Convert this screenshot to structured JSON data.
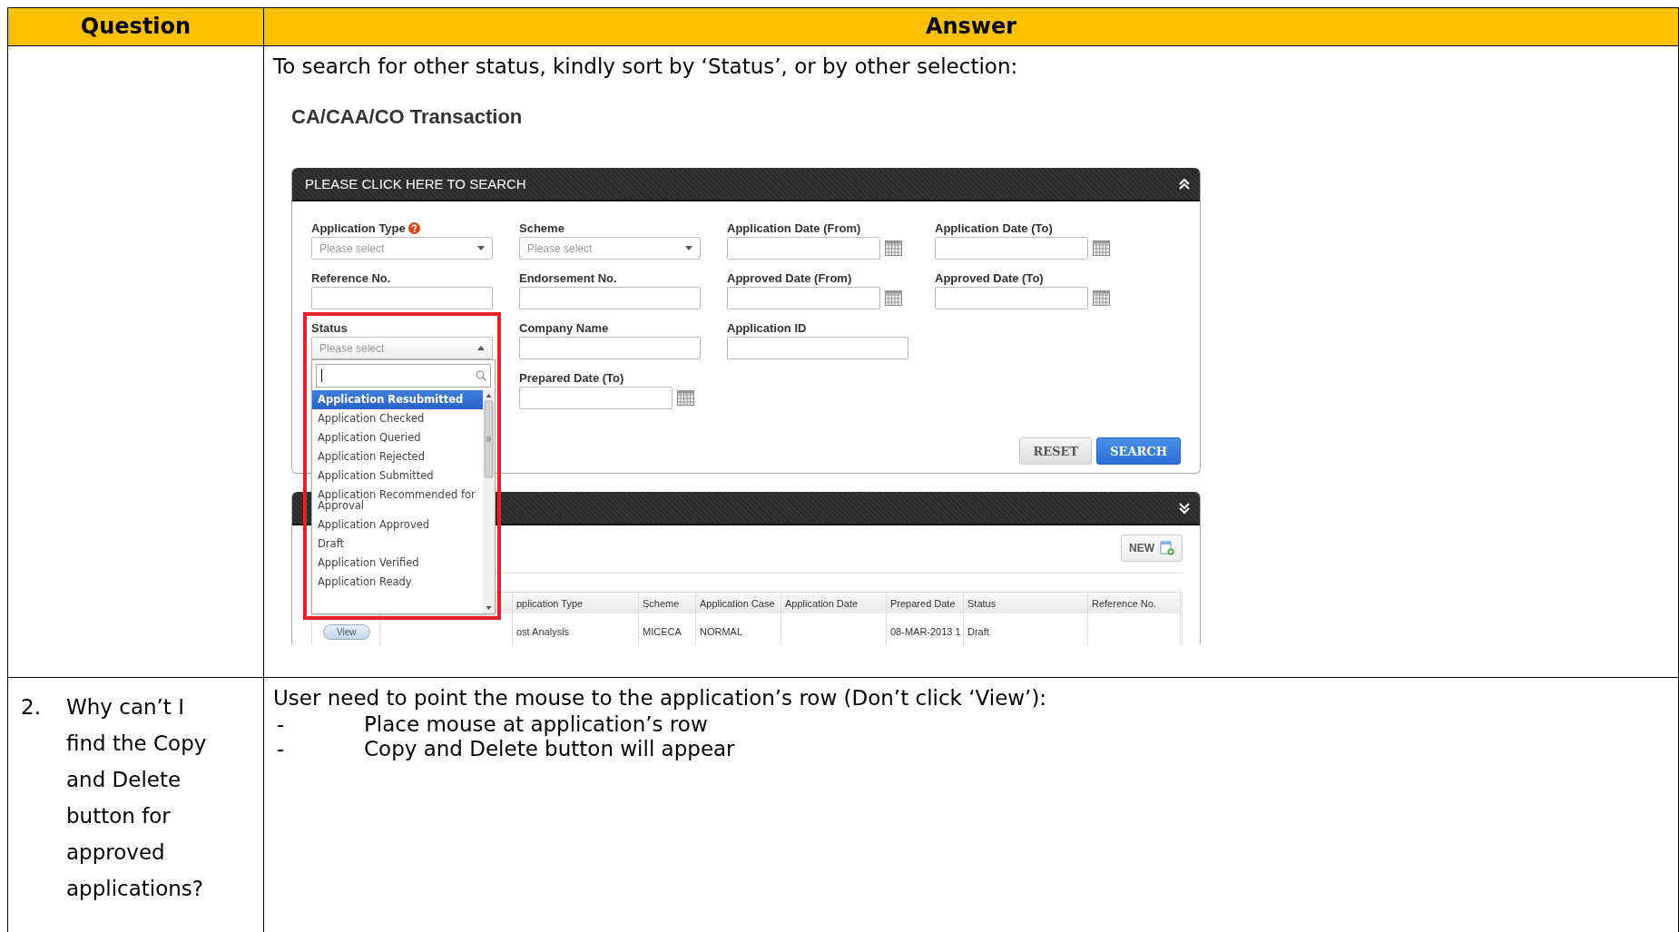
{
  "table": {
    "columns": [
      "Question",
      "Answer"
    ],
    "rows": [
      {
        "answer_intro": "To search for other status, kindly sort by ‘Status’, or by other selection:",
        "screenshot": {
          "page_title": "CA/CAA/CO Transaction",
          "search_panel": {
            "title": "PLEASE CLICK HERE TO SEARCH",
            "expanded": true,
            "field_columns": [
              [
                {
                  "label": "Application Type",
                  "kind": "select",
                  "placeholder": "Please select",
                  "help": true
                },
                {
                  "label": "Reference No.",
                  "kind": "text"
                },
                {
                  "label": "Status",
                  "kind": "select",
                  "placeholder": "Please select",
                  "highlighted": true,
                  "dropdown": {
                    "open": true,
                    "options": [
                      {
                        "label": "Application Resubmitted",
                        "selected": true
                      },
                      {
                        "label": "Application Checked",
                        "selected": false
                      },
                      {
                        "label": "Application Queried",
                        "selected": false
                      },
                      {
                        "label": "Application Rejected",
                        "selected": false
                      },
                      {
                        "label": "Application Submitted",
                        "selected": false
                      },
                      {
                        "label": "Application Recommended for Approval",
                        "selected": false
                      },
                      {
                        "label": "Application Approved",
                        "selected": false
                      },
                      {
                        "label": "Draft",
                        "selected": false
                      },
                      {
                        "label": "Application Verified",
                        "selected": false
                      },
                      {
                        "label": "Application Ready",
                        "selected": false
                      }
                    ]
                  }
                }
              ],
              [
                {
                  "label": "Scheme",
                  "kind": "select",
                  "placeholder": "Please select"
                },
                {
                  "label": "Endorsement No.",
                  "kind": "text"
                },
                {
                  "label": "Company Name",
                  "kind": "text"
                },
                {
                  "label": "Prepared Date (To)",
                  "kind": "date"
                }
              ],
              [
                {
                  "label": "Application Date (From)",
                  "kind": "date"
                },
                {
                  "label": "Approved Date (From)",
                  "kind": "date"
                },
                {
                  "label": "Application ID",
                  "kind": "text"
                }
              ],
              [
                {
                  "label": "Application Date (To)",
                  "kind": "date"
                },
                {
                  "label": "Approved Date (To)",
                  "kind": "date"
                }
              ]
            ],
            "buttons": [
              {
                "label": "RESET",
                "kind": "secondary"
              },
              {
                "label": "SEARCH",
                "kind": "primary"
              }
            ]
          },
          "results_panel": {
            "expanded": false,
            "new_button": "NEW",
            "columns": [
              "pplication Type",
              "Scheme",
              "Application Case",
              "Application Date",
              "Prepared Date",
              "Status",
              "Reference No."
            ],
            "rows": [
              {
                "action": "View",
                "cells": [
                  "ost Analysis",
                  "MICECA",
                  "NORMAL",
                  null,
                  "08-MAR-2013 1",
                  "Draft",
                  null
                ]
              }
            ]
          }
        }
      },
      {
        "number": "2.",
        "question": "Why can’t I find the Copy and Delete button for approved applications?",
        "answer_intro": "User need to point the mouse to the application’s row (Don’t click ‘View’):",
        "bullets": [
          {
            "marker": "-",
            "text": "Place mouse at application’s row"
          },
          {
            "marker": "-",
            "text": "Copy and Delete button will appear"
          }
        ]
      }
    ]
  }
}
